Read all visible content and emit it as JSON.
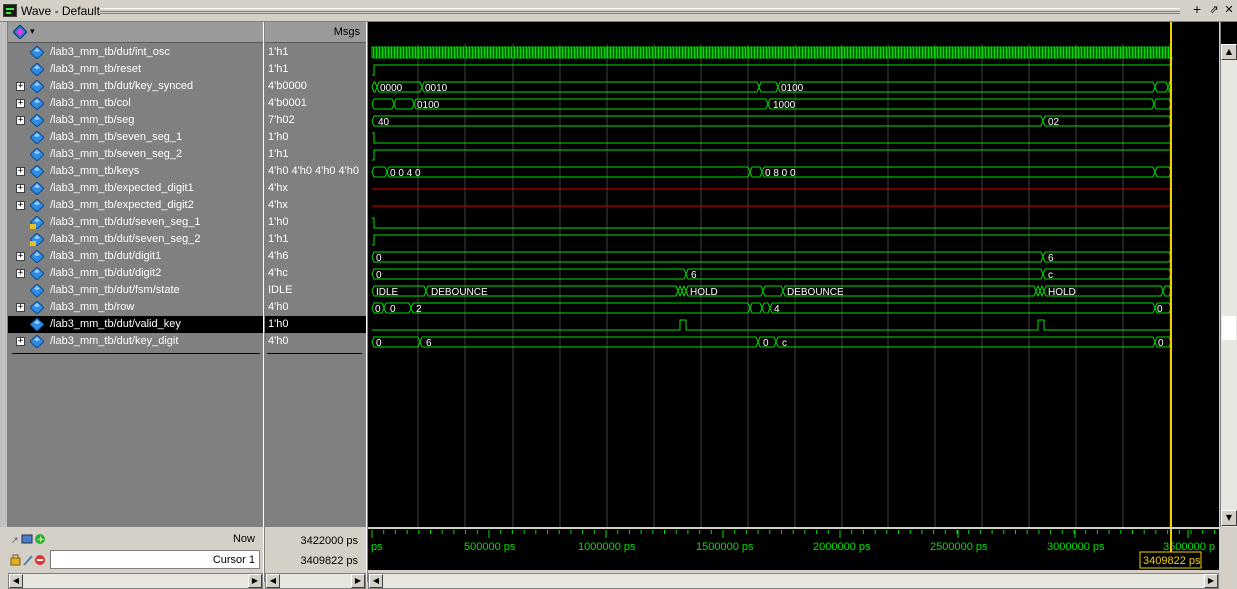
{
  "window": {
    "title": "Wave - Default",
    "controls": [
      "+",
      "⇗",
      "✕"
    ]
  },
  "panes": {
    "values_header": "Msgs"
  },
  "signals": [
    {
      "name": "/lab3_mm_tb/dut/int_osc",
      "value": "1'h1",
      "expandable": false,
      "icon": "signal-diamond-icon"
    },
    {
      "name": "/lab3_mm_tb/reset",
      "value": "1'h1",
      "expandable": false,
      "icon": "signal-diamond-icon"
    },
    {
      "name": "/lab3_mm_tb/dut/key_synced",
      "value": "4'b0000",
      "expandable": true,
      "icon": "signal-diamond-icon"
    },
    {
      "name": "/lab3_mm_tb/col",
      "value": "4'b0001",
      "expandable": true,
      "icon": "signal-diamond-icon"
    },
    {
      "name": "/lab3_mm_tb/seg",
      "value": "7'h02",
      "expandable": true,
      "icon": "signal-diamond-icon"
    },
    {
      "name": "/lab3_mm_tb/seven_seg_1",
      "value": "1'h0",
      "expandable": false,
      "icon": "signal-diamond-icon"
    },
    {
      "name": "/lab3_mm_tb/seven_seg_2",
      "value": "1'h1",
      "expandable": false,
      "icon": "signal-diamond-icon"
    },
    {
      "name": "/lab3_mm_tb/keys",
      "value": "4'h0 4'h0 4'h0 4'h0",
      "expandable": true,
      "icon": "signal-diamond-icon"
    },
    {
      "name": "/lab3_mm_tb/expected_digit1",
      "value": "4'hx",
      "expandable": true,
      "icon": "signal-diamond-icon"
    },
    {
      "name": "/lab3_mm_tb/expected_digit2",
      "value": "4'hx",
      "expandable": true,
      "icon": "signal-diamond-icon"
    },
    {
      "name": "/lab3_mm_tb/dut/seven_seg_1",
      "value": "1'h0",
      "expandable": false,
      "icon": "output-signal-icon"
    },
    {
      "name": "/lab3_mm_tb/dut/seven_seg_2",
      "value": "1'h1",
      "expandable": false,
      "icon": "output-signal-icon"
    },
    {
      "name": "/lab3_mm_tb/dut/digit1",
      "value": "4'h6",
      "expandable": true,
      "icon": "signal-diamond-icon"
    },
    {
      "name": "/lab3_mm_tb/dut/digit2",
      "value": "4'hc",
      "expandable": true,
      "icon": "signal-diamond-icon"
    },
    {
      "name": "/lab3_mm_tb/dut/fsm/state",
      "value": "IDLE",
      "expandable": false,
      "icon": "signal-diamond-icon"
    },
    {
      "name": "/lab3_mm_tb/row",
      "value": "4'h0",
      "expandable": true,
      "icon": "signal-diamond-icon"
    },
    {
      "name": "/lab3_mm_tb/dut/valid_key",
      "value": "1'h0",
      "expandable": false,
      "icon": "signal-diamond-icon",
      "selected": true
    },
    {
      "name": "/lab3_mm_tb/dut/key_digit",
      "value": "4'h0",
      "expandable": true,
      "icon": "signal-diamond-icon"
    }
  ],
  "wave_labels": {
    "key_synced": [
      "0000",
      "0010",
      "0100"
    ],
    "col": [
      "0100",
      "1000"
    ],
    "seg": [
      "40",
      "02"
    ],
    "keys": [
      "0 0 4 0",
      "0 8 0 0"
    ],
    "digit1": [
      "0",
      "6"
    ],
    "digit2": [
      "0",
      "6",
      "c"
    ],
    "state": [
      "IDLE",
      "DEBOUNCE",
      "HOLD",
      "DEBOUNCE",
      "HOLD"
    ],
    "row": [
      "0",
      "0",
      "2",
      "4",
      "0"
    ],
    "key_digit": [
      "0",
      "6",
      "0",
      "c",
      "0"
    ]
  },
  "status": {
    "now_label": "Now",
    "now_value": "3422000 ps",
    "cursor_label": "Cursor 1",
    "cursor_value": "3409822 ps",
    "cursor_readout": "3409822 ps"
  },
  "timeline": {
    "tick_labels": [
      "ps",
      "500000 ps",
      "1000000 ps",
      "1500000 ps",
      "2000000 ps",
      "2500000 ps",
      "3000000 ps",
      "3500000 p"
    ]
  },
  "colors": {
    "wave": "#00e000",
    "unknown": "#e00000",
    "cursor": "#f0d000",
    "grid": "#404040"
  }
}
